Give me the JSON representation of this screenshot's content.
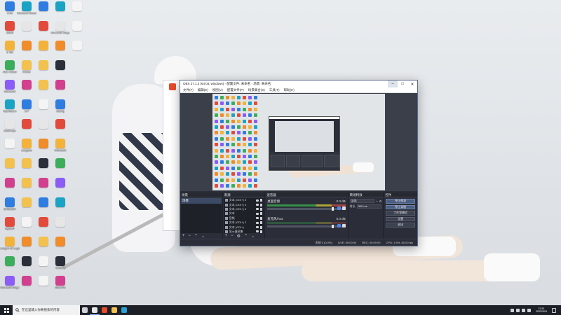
{
  "colors": {
    "obs_bg": "#2b2e38",
    "obs_dock": "#1f2129",
    "scene_selected": "#3c4a66",
    "meter_green": "#37a04b",
    "meter_yellow": "#c6b837",
    "meter_red": "#b84646",
    "taskbar": "#1c1f26",
    "volume_icon": "#4f86e8"
  },
  "desktop": {
    "icons": [
      {
        "label": "3 Ad",
        "icon": "app-icon"
      },
      {
        "label": "bilibili",
        "icon": "app-icon"
      },
      {
        "label": "9 Tell",
        "icon": "app-icon"
      },
      {
        "label": "Alan Ghost",
        "icon": "app-icon"
      },
      {
        "label": "Microsoft",
        "icon": "app-icon"
      },
      {
        "label": "MyoMacro",
        "icon": "app-icon"
      },
      {
        "label": "Netlamps",
        "icon": "app-icon"
      },
      {
        "label": "",
        "icon": "file-icon"
      },
      {
        "label": "",
        "icon": "folder-icon"
      },
      {
        "label": "",
        "icon": "app-icon"
      },
      {
        "label": "EVMMGF",
        "icon": "app-icon"
      },
      {
        "label": "MySUP",
        "icon": "app-icon"
      },
      {
        "label": "League of Legends",
        "icon": "app-icon"
      },
      {
        "label": "",
        "icon": "app-icon"
      },
      {
        "label": "Microsoft Edge",
        "icon": "app-icon"
      },
      {
        "label": "Microsoft Steam",
        "icon": "app-icon"
      },
      {
        "label": "",
        "icon": "app-icon"
      },
      {
        "label": "",
        "icon": "app-icon"
      },
      {
        "label": "Folder",
        "icon": "folder-icon"
      },
      {
        "label": "",
        "icon": "app-icon"
      },
      {
        "label": "LIT",
        "icon": "app-icon"
      },
      {
        "label": "",
        "icon": "app-icon"
      },
      {
        "label": "Leagues",
        "icon": "app-icon"
      },
      {
        "label": "",
        "icon": "folder-icon"
      },
      {
        "label": "",
        "icon": "folder-icon"
      },
      {
        "label": "",
        "icon": "folder-icon"
      },
      {
        "label": "",
        "icon": "file-icon"
      },
      {
        "label": "",
        "icon": "app-icon"
      },
      {
        "label": "",
        "icon": "app-icon"
      },
      {
        "label": "",
        "icon": "app-icon"
      },
      {
        "label": "",
        "icon": "app-icon"
      },
      {
        "label": "",
        "icon": "app-icon"
      },
      {
        "label": "",
        "icon": "app-icon"
      },
      {
        "label": "",
        "icon": "folder-icon"
      },
      {
        "label": "",
        "icon": "folder-icon"
      },
      {
        "label": "",
        "icon": "file-icon"
      },
      {
        "label": "",
        "icon": "app-icon"
      },
      {
        "label": "",
        "icon": "app-icon"
      },
      {
        "label": "",
        "icon": "app-icon"
      },
      {
        "label": "",
        "icon": "app-icon"
      },
      {
        "label": "",
        "icon": "app-icon"
      },
      {
        "label": "",
        "icon": "app-icon"
      },
      {
        "label": "",
        "icon": "folder-icon"
      },
      {
        "label": "",
        "icon": "file-icon"
      },
      {
        "label": "",
        "icon": "file-icon"
      },
      {
        "label": "",
        "icon": "app-icon"
      },
      {
        "label": "Microsoft Edge",
        "icon": "edge-icon"
      },
      {
        "label": "",
        "icon": "app-icon"
      },
      {
        "label": "",
        "icon": "app-icon"
      },
      {
        "label": "",
        "icon": "app-icon"
      },
      {
        "label": "dialing",
        "icon": "app-icon"
      },
      {
        "label": "",
        "icon": "app-icon"
      },
      {
        "label": "Microsoft",
        "icon": "app-icon"
      },
      {
        "label": "",
        "icon": "app-icon"
      },
      {
        "label": "",
        "icon": "app-icon"
      },
      {
        "label": "",
        "icon": "app-icon"
      },
      {
        "label": "",
        "icon": "app-icon"
      },
      {
        "label": "",
        "icon": "app-icon"
      },
      {
        "label": "Youtube",
        "icon": "app-icon"
      },
      {
        "label": "MicroFix",
        "icon": "app-icon"
      },
      {
        "label": "",
        "icon": "file-icon"
      },
      {
        "label": "",
        "icon": "file-icon"
      },
      {
        "label": "",
        "icon": "file-icon"
      }
    ]
  },
  "browser_partial": {
    "items": [
      "",
      "",
      ""
    ]
  },
  "obs": {
    "title": "OBS 27.1.3 (64 bit, windows) - 配置文件: 未命名 - 场景: 未命名",
    "menu": [
      "文件(F)",
      "编辑(E)",
      "视图(V)",
      "配置文件(P)",
      "场景集合(S)",
      "工具(T)",
      "帮助(H)"
    ],
    "window_buttons": {
      "minimize": "–",
      "maximize": "□",
      "close": "✕"
    },
    "docks": {
      "scenes": {
        "title": "场景",
        "items": [
          "场景"
        ]
      },
      "sources": {
        "title": "来源",
        "items": [
          "文本 (GDI+) 5",
          "文本 (GDI+) 4",
          "文本 (GDI+) 3",
          "文本",
          "音频",
          "文本 (GDI+) 2",
          "文本 (GDI+)",
          "显示器采集"
        ]
      },
      "mixer": {
        "title": "混音器",
        "tracks": [
          {
            "name": "桌面音频",
            "db": "0.0 dB",
            "level": 0.72
          },
          {
            "name": "麦克风/Aux",
            "db": "0.0 dB",
            "level": 0.18
          }
        ]
      },
      "transitions": {
        "title": "转场特效",
        "type_value": "淡出",
        "duration_label": "时长",
        "duration_value": "300 ms"
      },
      "controls": {
        "title": "控件",
        "buttons": [
          "停止推流",
          "停止录制",
          "工作室模式",
          "设置",
          "退出"
        ]
      }
    },
    "footer_glyphs": {
      "add": "+",
      "remove": "−",
      "settings": "⚙",
      "up": "⌃",
      "down": "⌄"
    },
    "status": {
      "dropped": "丢帧 0 (0.0%)",
      "live": "LIVE: 00:00:00",
      "rec": "REC: 00:00:00",
      "cpu": "CPU: 1.5%, 60.00 fps"
    }
  },
  "taskbar": {
    "search_placeholder": "在这里输入你要搜索的内容",
    "apps": [
      {
        "icon": "task-view-icon",
        "color": "#cfd3d8"
      },
      {
        "icon": "obs-icon",
        "color": "#e6e6e6"
      },
      {
        "icon": "chrome-icon",
        "color": "#e84a2b"
      },
      {
        "icon": "folder-icon",
        "color": "#f2c14e"
      },
      {
        "icon": "edge-icon",
        "color": "#2aa0d8"
      }
    ],
    "clock_time": "21:51",
    "clock_date": "2022/3/24"
  }
}
